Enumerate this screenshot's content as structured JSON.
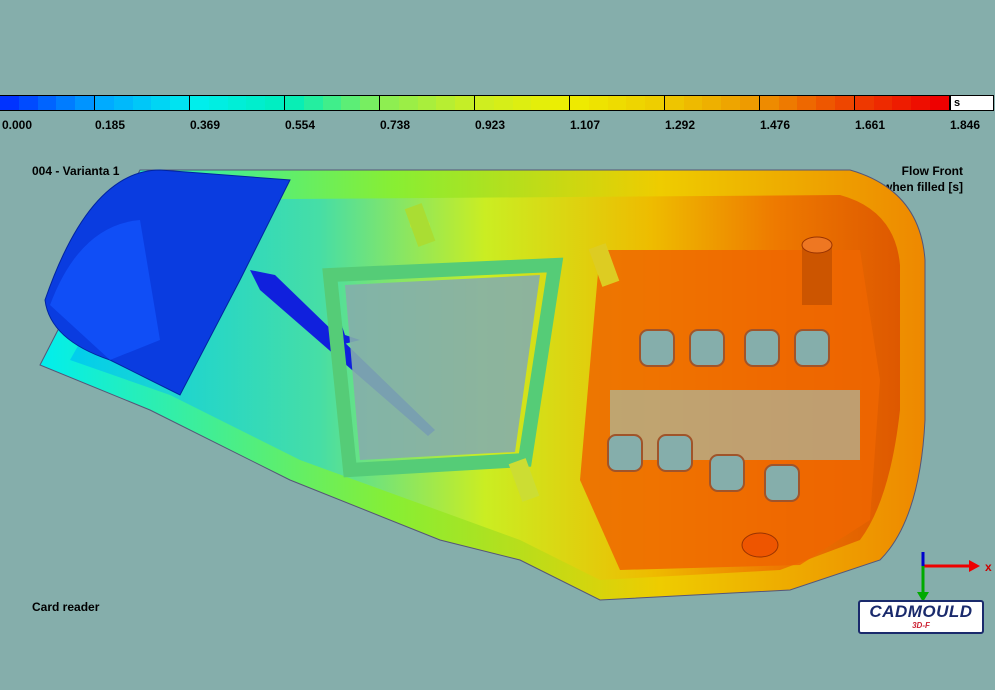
{
  "legend": {
    "unit": "s",
    "ticks": [
      "0.000",
      "0.185",
      "0.369",
      "0.554",
      "0.738",
      "0.923",
      "1.107",
      "1.292",
      "1.476",
      "1.661",
      "1.846"
    ],
    "colors": [
      "#0033ff",
      "#00aaff",
      "#00eeee",
      "#00eebb",
      "#88ee55",
      "#ccee22",
      "#eeee00",
      "#eecc00",
      "#ee9900",
      "#ee4400",
      "#ee0000"
    ]
  },
  "header": {
    "study_name": "004 - Varianta 1",
    "result_type": "Flow Front",
    "result_subtitle": "Time when filled [s]"
  },
  "footer": {
    "part_name": "Card reader",
    "logo_text": "CADMOULD",
    "logo_sub": "3D-F"
  },
  "axes": {
    "x": "x"
  }
}
